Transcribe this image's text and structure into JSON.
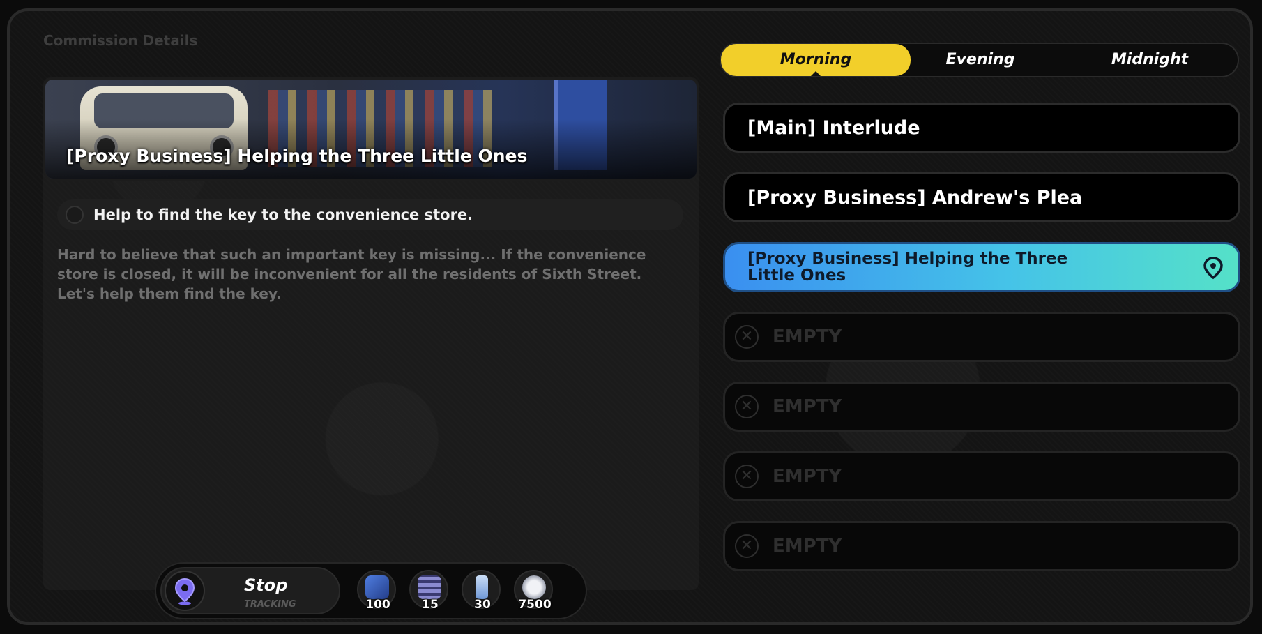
{
  "header": {
    "title": "Commission Details"
  },
  "detail": {
    "banner_title": "[Proxy Business] Helping the Three Little Ones",
    "objective": "Help to find the key to the convenience store.",
    "description": "Hard to believe that such an important key is missing... If the convenience store is closed, it will be inconvenient for all the residents of Sixth Street. Let's help them find the key."
  },
  "tracking": {
    "button_label": "Stop",
    "status_label": "TRACKING",
    "pin_icon": "location-pin-icon"
  },
  "rewards": [
    {
      "icon": "intel-map-icon",
      "count": "100",
      "color": "#3c63c8"
    },
    {
      "icon": "film-reel-icon",
      "count": "15",
      "color": "#6a6ab0"
    },
    {
      "icon": "battery-icon",
      "count": "30",
      "color": "#7aa0d8"
    },
    {
      "icon": "denny-coin-icon",
      "count": "7500",
      "color": "#c9ccd6"
    }
  ],
  "tabs": [
    {
      "label": "Morning",
      "active": true
    },
    {
      "label": "Evening",
      "active": false
    },
    {
      "label": "Midnight",
      "active": false
    }
  ],
  "commissions": [
    {
      "title": "[Main] Interlude",
      "state": "normal"
    },
    {
      "title": "[Proxy Business] Andrew's Plea",
      "state": "normal"
    },
    {
      "title": "[Proxy Business] Helping the Three Little Ones",
      "state": "active"
    },
    {
      "title": "EMPTY",
      "state": "empty"
    },
    {
      "title": "EMPTY",
      "state": "empty"
    },
    {
      "title": "EMPTY",
      "state": "empty"
    },
    {
      "title": "EMPTY",
      "state": "empty"
    }
  ],
  "colors": {
    "tab_active": "#f2cf2a",
    "active_gradient_start": "#3a8ff0",
    "active_gradient_end": "#55e1c8",
    "pin_purple": "#7b6cf0"
  }
}
